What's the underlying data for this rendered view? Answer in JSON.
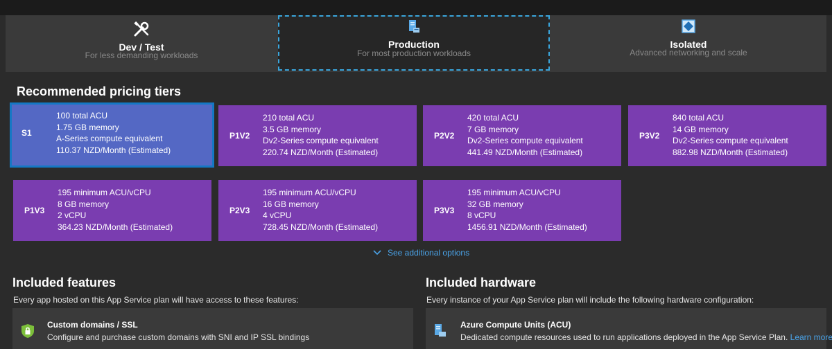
{
  "tabs": [
    {
      "title": "Dev / Test",
      "subtitle": "For less demanding workloads",
      "icon": "tools-icon"
    },
    {
      "title": "Production",
      "subtitle": "For most production workloads",
      "icon": "server-icon"
    },
    {
      "title": "Isolated",
      "subtitle": "Advanced networking and scale",
      "icon": "isolated-icon"
    }
  ],
  "recommended": {
    "title": "Recommended pricing tiers",
    "tiers": [
      {
        "name": "S1",
        "lines": [
          "100 total ACU",
          "1.75 GB memory",
          "A-Series compute equivalent",
          "110.37 NZD/Month (Estimated)"
        ],
        "selected": true
      },
      {
        "name": "P1V2",
        "lines": [
          "210 total ACU",
          "3.5 GB memory",
          "Dv2-Series compute equivalent",
          "220.74 NZD/Month (Estimated)"
        ]
      },
      {
        "name": "P2V2",
        "lines": [
          "420 total ACU",
          "7 GB memory",
          "Dv2-Series compute equivalent",
          "441.49 NZD/Month (Estimated)"
        ]
      },
      {
        "name": "P3V2",
        "lines": [
          "840 total ACU",
          "14 GB memory",
          "Dv2-Series compute equivalent",
          "882.98 NZD/Month (Estimated)"
        ]
      },
      {
        "name": "P1V3",
        "lines": [
          "195 minimum ACU/vCPU",
          "8 GB memory",
          "2 vCPU",
          "364.23 NZD/Month (Estimated)"
        ]
      },
      {
        "name": "P2V3",
        "lines": [
          "195 minimum ACU/vCPU",
          "16 GB memory",
          "4 vCPU",
          "728.45 NZD/Month (Estimated)"
        ]
      },
      {
        "name": "P3V3",
        "lines": [
          "195 minimum ACU/vCPU",
          "32 GB memory",
          "8 vCPU",
          "1456.91 NZD/Month (Estimated)"
        ]
      }
    ],
    "see_more": "See additional options"
  },
  "features": {
    "title": "Included features",
    "description": "Every app hosted on this App Service plan will have access to these features:",
    "item": {
      "title": "Custom domains / SSL",
      "text": "Configure and purchase custom domains with SNI and IP SSL bindings",
      "icon": "shield-lock-icon"
    }
  },
  "hardware": {
    "title": "Included hardware",
    "description": "Every instance of your App Service plan will include the following hardware configuration:",
    "item": {
      "title": "Azure Compute Units (ACU)",
      "text": "Dedicated compute resources used to run applications deployed in the App Service Plan.",
      "link": "Learn more",
      "icon": "compute-units-icon"
    }
  },
  "colors": {
    "background": "#2b2b2b",
    "tier_card": "#7a3db0",
    "tier_selected": "#5468c4",
    "selected_border": "#1578c4",
    "focus_dashed": "#3aa6dd",
    "link": "#4aa3e8"
  }
}
